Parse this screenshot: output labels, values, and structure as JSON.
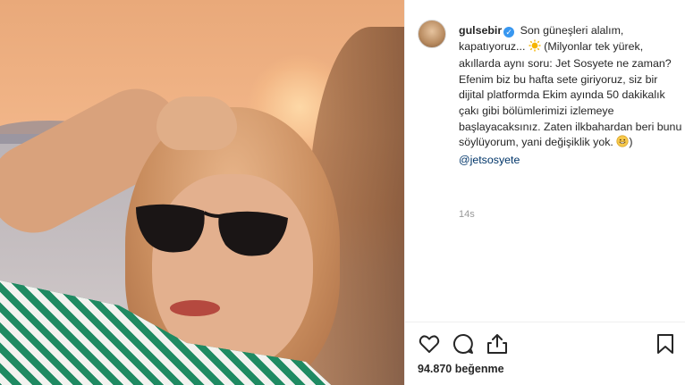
{
  "post": {
    "username": "gulsebir",
    "caption_part1": "Son güneşleri alalım, kapatıyoruz...",
    "caption_part2": "(Milyonlar tek yürek, akıllarda aynı soru: Jet Sosyete ne zaman? Efenim biz bu hafta sete giriyoruz, siz bir dijital platformda Ekim ayında 50 dakikalık çakı gibi bölümlerimizi izlemeye başlayacaksınız. Zaten ilkbahardan beri bunu söylüyorum, yani değişiklik yok.",
    "caption_end": ")",
    "mention": "@jetsosyete",
    "time_ago": "14s",
    "likes": "94.870 beğenme",
    "icons": [
      "verified-badge",
      "sun-emoji",
      "grinning-emoji",
      "heart-icon",
      "comment-icon",
      "share-icon",
      "bookmark-icon"
    ]
  },
  "colors": {
    "text": "#262626",
    "muted": "#999999",
    "verified": "#3897f0",
    "mention": "#003569"
  }
}
